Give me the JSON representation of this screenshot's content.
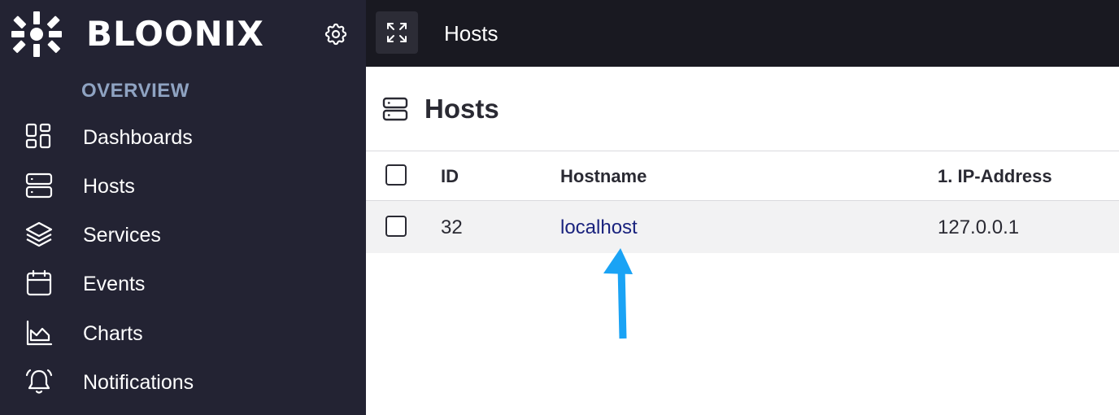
{
  "app": {
    "brand": "BLOONIX",
    "logo_icon": "bloonix-logo-icon",
    "settings_icon": "gear-icon"
  },
  "sidebar": {
    "section_label": "OVERVIEW",
    "items": [
      {
        "label": "Dashboards",
        "icon": "dashboard-grid-icon"
      },
      {
        "label": "Hosts",
        "icon": "server-stack-icon"
      },
      {
        "label": "Services",
        "icon": "layers-icon"
      },
      {
        "label": "Events",
        "icon": "calendar-icon"
      },
      {
        "label": "Charts",
        "icon": "area-chart-icon"
      },
      {
        "label": "Notifications",
        "icon": "bell-ringing-icon"
      }
    ]
  },
  "topbar": {
    "title": "Hosts",
    "expand_icon": "expand-arrows-icon"
  },
  "main": {
    "title": "Hosts",
    "title_icon": "server-stack-icon",
    "table": {
      "columns": [
        "ID",
        "Hostname",
        "1. IP-Address"
      ],
      "rows": [
        {
          "checked": false,
          "id": "32",
          "hostname": "localhost",
          "ip": "127.0.0.1"
        }
      ]
    }
  },
  "annotation": {
    "type": "arrow-pointing-up",
    "target": "localhost",
    "color": "#1aa3f5"
  },
  "colors": {
    "sidebar_bg": "#232333",
    "topbar_bg": "#191921",
    "section_label": "#8fa3c2",
    "link": "#1a237e",
    "row_bg": "#f2f2f3"
  }
}
